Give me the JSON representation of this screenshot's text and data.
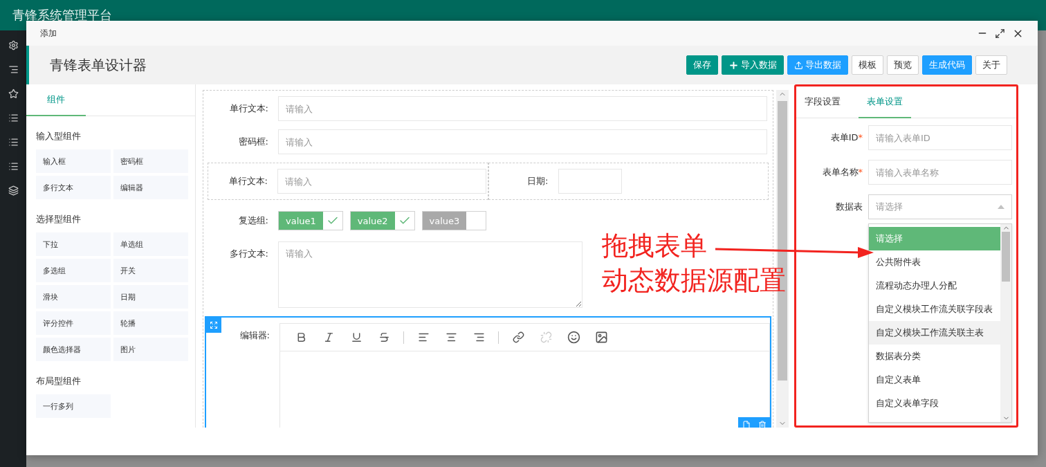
{
  "app": {
    "title": "青锋系统管理平台"
  },
  "dialog": {
    "title": "添加"
  },
  "designer": {
    "title": "青锋表单设计器",
    "buttons": [
      {
        "label": "保存",
        "kind": "primary"
      },
      {
        "label": "导入数据",
        "kind": "add"
      },
      {
        "label": "导出数据",
        "kind": "export"
      },
      {
        "label": "模板",
        "kind": "plain"
      },
      {
        "label": "预览",
        "kind": "plain"
      },
      {
        "label": "生成代码",
        "kind": "info"
      },
      {
        "label": "关于",
        "kind": "plain"
      }
    ]
  },
  "palette": {
    "tabs": [
      {
        "label": "组件",
        "selected": true
      }
    ],
    "groups": [
      {
        "title": "输入型组件",
        "items": [
          "输入框",
          "密码框",
          "多行文本",
          "编辑器"
        ]
      },
      {
        "title": "选择型组件",
        "items": [
          "下拉",
          "单选组",
          "多选组",
          "开关",
          "滑块",
          "日期",
          "评分控件",
          "轮播",
          "颜色选择器",
          "图片"
        ]
      },
      {
        "title": "布局型组件",
        "items": [
          "一行多列"
        ]
      }
    ]
  },
  "canvas": {
    "fields": [
      {
        "kind": "input",
        "label": "单行文本:",
        "placeholder": "请输入"
      },
      {
        "kind": "input",
        "label": "密码框:",
        "placeholder": "请输入"
      },
      {
        "kind": "grid",
        "cells": [
          {
            "label": "单行文本:",
            "placeholder": "请输入"
          },
          {
            "label": "日期:"
          }
        ]
      },
      {
        "kind": "checkbox",
        "label": "复选组:",
        "options": [
          {
            "label": "value1",
            "checked": true
          },
          {
            "label": "value2",
            "checked": true
          },
          {
            "label": "value3",
            "checked": false
          }
        ]
      },
      {
        "kind": "textarea",
        "label": "多行文本:",
        "placeholder": "请输入"
      },
      {
        "kind": "editor",
        "label": "编辑器:",
        "selected": true
      }
    ]
  },
  "settings": {
    "tabs": [
      {
        "label": "字段设置",
        "selected": false
      },
      {
        "label": "表单设置",
        "selected": true
      }
    ],
    "fields": [
      {
        "kind": "input",
        "label": "表单ID",
        "required_mark": "*",
        "placeholder": "请输入表单ID"
      },
      {
        "kind": "input",
        "label": "表单名称",
        "required_mark": "*",
        "placeholder": "请输入表单名称"
      },
      {
        "kind": "select",
        "label": "数据表",
        "placeholder": "请选择",
        "expanded": true
      }
    ],
    "options": [
      {
        "label": "请选择",
        "selected": true,
        "hovered": false
      },
      {
        "label": "公共附件表",
        "selected": false,
        "hovered": false
      },
      {
        "label": "流程动态办理人分配",
        "selected": false,
        "hovered": false
      },
      {
        "label": "自定义模块工作流关联字段表",
        "selected": false,
        "hovered": false
      },
      {
        "label": "自定义模块工作流关联主表",
        "selected": false,
        "hovered": true
      },
      {
        "label": "数据表分类",
        "selected": false,
        "hovered": false
      },
      {
        "label": "自定义表单",
        "selected": false,
        "hovered": false
      },
      {
        "label": "自定义表单字段",
        "selected": false,
        "hovered": false
      }
    ]
  },
  "annotation": {
    "lines": [
      "拖拽表单",
      "动态数据源配置"
    ]
  }
}
